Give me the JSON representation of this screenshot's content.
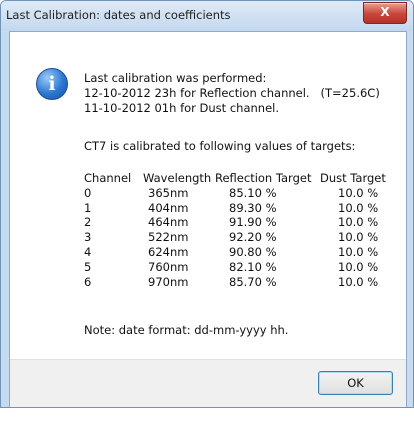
{
  "window": {
    "title": "Last Calibration: dates and coefficients",
    "close_label": "X"
  },
  "icon": {
    "name": "info-icon",
    "glyph": "i"
  },
  "message": {
    "line1": "Last calibration was performed:",
    "line2": "12-10-2012 23h for Reflection channel.   (T=25.6C)",
    "line3": "11-10-2012 01h for Dust channel.",
    "line4": "CT7 is calibrated to following values of targets:",
    "note": "Note: date format: dd-mm-yyyy hh."
  },
  "table": {
    "headers": [
      "Channel",
      "Wavelength",
      "Reflection Target",
      "Dust Target"
    ],
    "rows": [
      [
        "0",
        "365nm",
        "85.10 %",
        "10.0 %"
      ],
      [
        "1",
        "404nm",
        "89.30 %",
        "10.0 %"
      ],
      [
        "2",
        "464nm",
        "91.90 %",
        "10.0 %"
      ],
      [
        "3",
        "522nm",
        "92.20 %",
        "10.0 %"
      ],
      [
        "4",
        "624nm",
        "90.80 %",
        "10.0 %"
      ],
      [
        "5",
        "760nm",
        "82.10 %",
        "10.0 %"
      ],
      [
        "6",
        "970nm",
        "85.70 %",
        "10.0 %"
      ]
    ]
  },
  "footer": {
    "ok_label": "OK"
  }
}
